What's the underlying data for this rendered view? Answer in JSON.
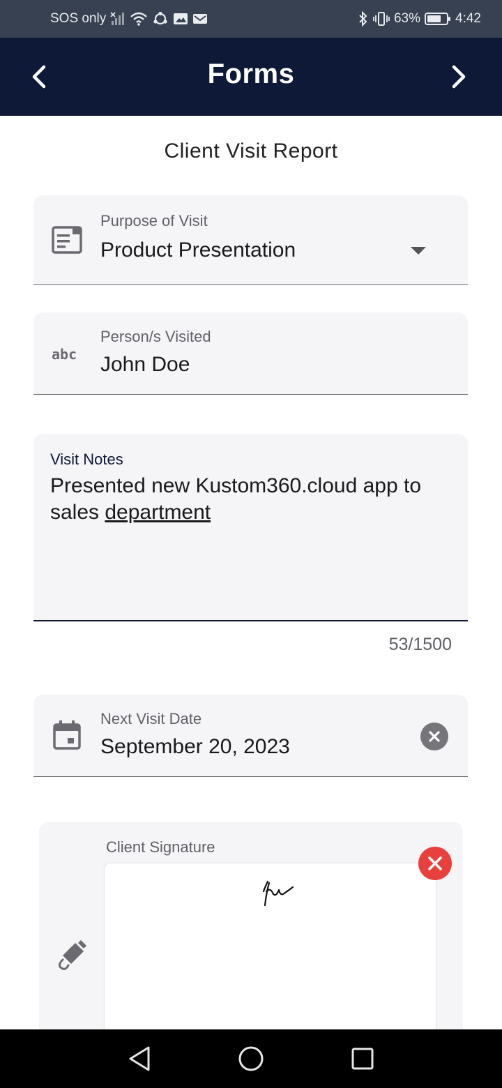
{
  "status_bar": {
    "carrier": "SOS only",
    "battery": "63%",
    "time": "4:42"
  },
  "app_bar": {
    "title": "Forms"
  },
  "form": {
    "title": "Client Visit Report",
    "purpose": {
      "label": "Purpose of Visit",
      "value": "Product Presentation"
    },
    "person": {
      "label": "Person/s Visited",
      "value": "John Doe"
    },
    "notes": {
      "label": "Visit Notes",
      "text_main": "Presented new Kustom360.cloud app to sales ",
      "text_underlined": "department",
      "counter": "53/1500"
    },
    "next_visit": {
      "label": "Next Visit Date",
      "value": "September 20, 2023"
    },
    "signature": {
      "label": "Client Signature"
    }
  },
  "colors": {
    "app_bar": "#0e1837",
    "status_bar": "#374151",
    "field_bg": "#f5f5f7",
    "clear_red": "#e8403c"
  }
}
